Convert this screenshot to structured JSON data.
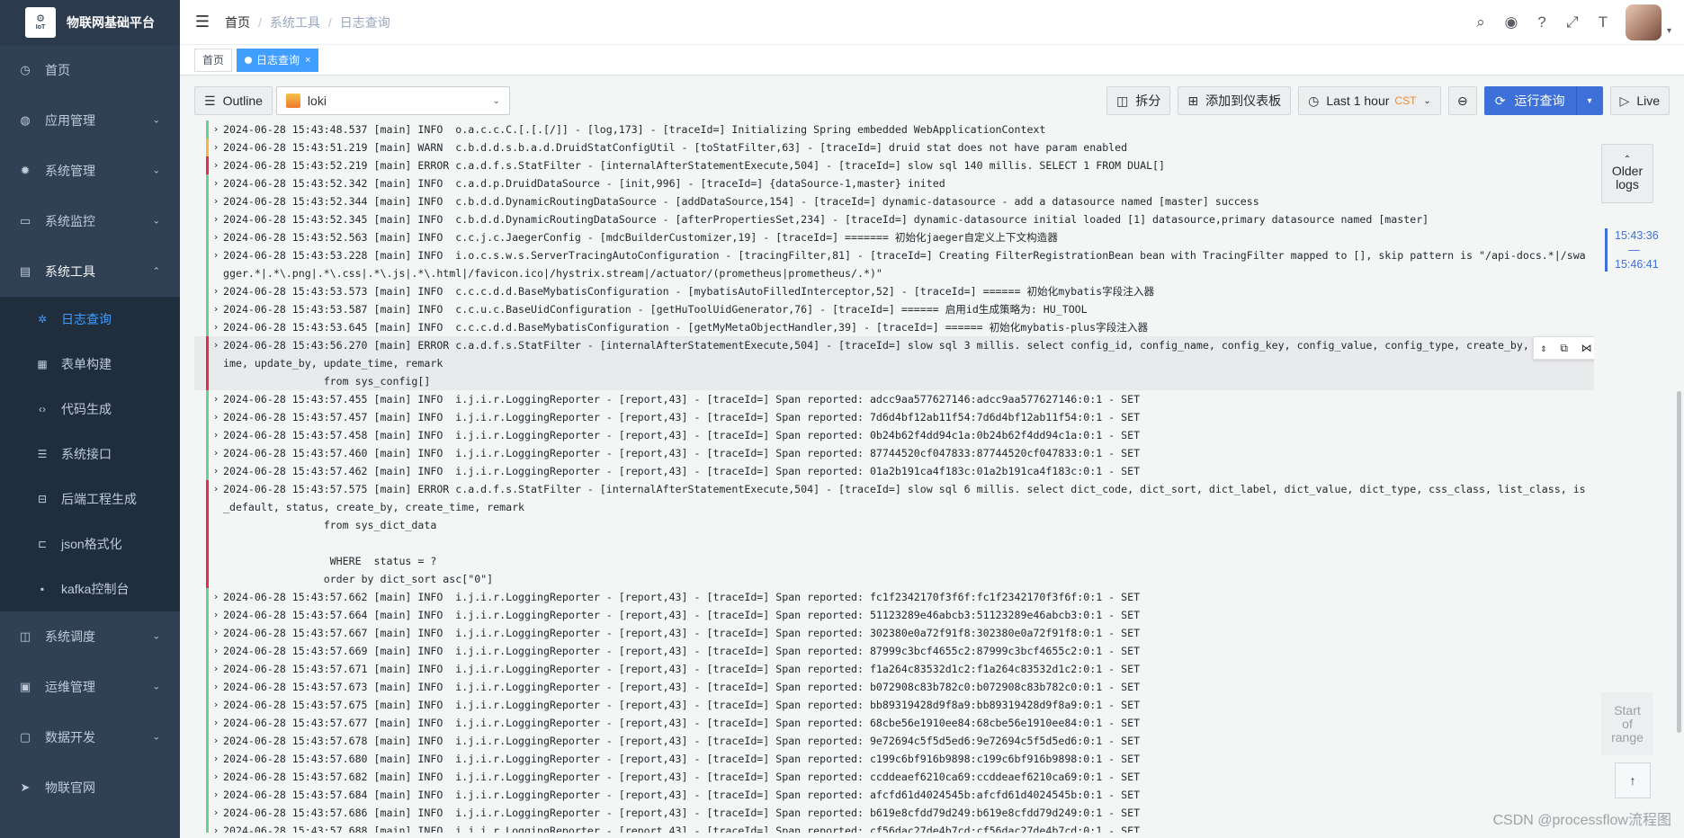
{
  "app": {
    "title": "物联网基础平台",
    "logo_text": "IoT"
  },
  "sidebar": {
    "items": [
      {
        "label": "首页",
        "icon": "dashboard-icon"
      },
      {
        "label": "应用管理",
        "icon": "globe-icon"
      },
      {
        "label": "系统管理",
        "icon": "gear-icon"
      },
      {
        "label": "系统监控",
        "icon": "monitor-icon"
      },
      {
        "label": "系统工具",
        "icon": "toolbox-icon"
      },
      {
        "label": "系统调度",
        "icon": "schedule-icon"
      },
      {
        "label": "运维管理",
        "icon": "ops-icon"
      },
      {
        "label": "数据开发",
        "icon": "data-icon"
      },
      {
        "label": "物联官网",
        "icon": "send-icon"
      }
    ],
    "sub_items": [
      {
        "label": "日志查询",
        "icon": "bug-icon"
      },
      {
        "label": "表单构建",
        "icon": "form-icon"
      },
      {
        "label": "代码生成",
        "icon": "code-icon"
      },
      {
        "label": "系统接口",
        "icon": "api-icon"
      },
      {
        "label": "后端工程生成",
        "icon": "build-icon"
      },
      {
        "label": "json格式化",
        "icon": "json-icon"
      },
      {
        "label": "kafka控制台",
        "icon": "chat-icon"
      }
    ]
  },
  "breadcrumb": {
    "home": "首页",
    "sep": "/",
    "level1": "系统工具",
    "level2": "日志查询"
  },
  "tags": {
    "home": "首页",
    "active": "日志查询",
    "close": "×"
  },
  "toolbar": {
    "outline": "Outline",
    "datasource": "loki",
    "split": "拆分",
    "add_dashboard": "添加到仪表板",
    "time_range": "Last 1 hour",
    "timezone": "CST",
    "run": "运行查询",
    "live": "Live"
  },
  "nav": {
    "older_1": "Older",
    "older_2": "logs",
    "range_start": "15:43:36",
    "range_dash": "—",
    "range_end": "15:46:41",
    "start_1": "Start",
    "start_2": "of",
    "start_3": "range",
    "to_top": "↑"
  },
  "watermark": "CSDN @processflow流程图",
  "logs": [
    {
      "level": "info",
      "text": "2024-06-28 15:43:48.537 [main] INFO  o.a.c.c.C.[.[.[/]] - [log,173] - [traceId=] Initializing Spring embedded WebApplicationContext"
    },
    {
      "level": "warn",
      "text": "2024-06-28 15:43:51.219 [main] WARN  c.b.d.d.s.b.a.d.DruidStatConfigUtil - [toStatFilter,63] - [traceId=] druid stat does not have param enabled"
    },
    {
      "level": "error",
      "text": "2024-06-28 15:43:52.219 [main] ERROR c.a.d.f.s.StatFilter - [internalAfterStatementExecute,504] - [traceId=] slow sql 140 millis. SELECT 1 FROM DUAL[]"
    },
    {
      "level": "info",
      "text": "2024-06-28 15:43:52.342 [main] INFO  c.a.d.p.DruidDataSource - [init,996] - [traceId=] {dataSource-1,master} inited"
    },
    {
      "level": "info",
      "text": "2024-06-28 15:43:52.344 [main] INFO  c.b.d.d.DynamicRoutingDataSource - [addDataSource,154] - [traceId=] dynamic-datasource - add a datasource named [master] success"
    },
    {
      "level": "info",
      "text": "2024-06-28 15:43:52.345 [main] INFO  c.b.d.d.DynamicRoutingDataSource - [afterPropertiesSet,234] - [traceId=] dynamic-datasource initial loaded [1] datasource,primary datasource named [master]"
    },
    {
      "level": "info",
      "text": "2024-06-28 15:43:52.563 [main] INFO  c.c.j.c.JaegerConfig - [mdcBuilderCustomizer,19] - [traceId=] ======= 初始化jaeger自定义上下文构造器"
    },
    {
      "level": "info",
      "text": "2024-06-28 15:43:53.228 [main] INFO  i.o.c.s.w.s.ServerTracingAutoConfiguration - [tracingFilter,81] - [traceId=] Creating FilterRegistrationBean bean with TracingFilter mapped to [], skip pattern is \"/api-docs.*|/swagger.*|.*\\.png|.*\\.css|.*\\.js|.*\\.html|/favicon.ico|/hystrix.stream|/actuator/(prometheus|prometheus/.*)\""
    },
    {
      "level": "info",
      "text": "2024-06-28 15:43:53.573 [main] INFO  c.c.c.d.d.BaseMybatisConfiguration - [mybatisAutoFilledInterceptor,52] - [traceId=] ====== 初始化mybatis字段注入器"
    },
    {
      "level": "info",
      "text": "2024-06-28 15:43:53.587 [main] INFO  c.c.u.c.BaseUidConfiguration - [getHuToolUidGenerator,76] - [traceId=] ====== 启用id生成策略为: HU_TOOL"
    },
    {
      "level": "info",
      "text": "2024-06-28 15:43:53.645 [main] INFO  c.c.c.d.d.BaseMybatisConfiguration - [getMyMetaObjectHandler,39] - [traceId=] ====== 初始化mybatis-plus字段注入器"
    },
    {
      "level": "error",
      "text": "2024-06-28 15:43:56.270 [main] ERROR c.a.d.f.s.StatFilter - [internalAfterStatementExecute,504] - [traceId=] slow sql 3 millis. select config_id, config_name, config_key, config_value, config_type, create_by, create_time, update_by, update_time, remark\n\t\tfrom sys_config[]",
      "selected": true
    },
    {
      "level": "info",
      "text": "2024-06-28 15:43:57.455 [main] INFO  i.j.i.r.LoggingReporter - [report,43] - [traceId=] Span reported: adcc9aa577627146:adcc9aa577627146:0:1 - SET"
    },
    {
      "level": "info",
      "text": "2024-06-28 15:43:57.457 [main] INFO  i.j.i.r.LoggingReporter - [report,43] - [traceId=] Span reported: 7d6d4bf12ab11f54:7d6d4bf12ab11f54:0:1 - SET"
    },
    {
      "level": "info",
      "text": "2024-06-28 15:43:57.458 [main] INFO  i.j.i.r.LoggingReporter - [report,43] - [traceId=] Span reported: 0b24b62f4dd94c1a:0b24b62f4dd94c1a:0:1 - SET"
    },
    {
      "level": "info",
      "text": "2024-06-28 15:43:57.460 [main] INFO  i.j.i.r.LoggingReporter - [report,43] - [traceId=] Span reported: 87744520cf047833:87744520cf047833:0:1 - SET"
    },
    {
      "level": "info",
      "text": "2024-06-28 15:43:57.462 [main] INFO  i.j.i.r.LoggingReporter - [report,43] - [traceId=] Span reported: 01a2b191ca4f183c:01a2b191ca4f183c:0:1 - SET"
    },
    {
      "level": "error",
      "text": "2024-06-28 15:43:57.575 [main] ERROR c.a.d.f.s.StatFilter - [internalAfterStatementExecute,504] - [traceId=] slow sql 6 millis. select dict_code, dict_sort, dict_label, dict_value, dict_type, css_class, list_class, is_default, status, create_by, create_time, remark\n\t\tfrom sys_dict_data\n\n\t\t WHERE  status = ?\n\t\torder by dict_sort asc[\"0\"]"
    },
    {
      "level": "info",
      "text": "2024-06-28 15:43:57.662 [main] INFO  i.j.i.r.LoggingReporter - [report,43] - [traceId=] Span reported: fc1f2342170f3f6f:fc1f2342170f3f6f:0:1 - SET"
    },
    {
      "level": "info",
      "text": "2024-06-28 15:43:57.664 [main] INFO  i.j.i.r.LoggingReporter - [report,43] - [traceId=] Span reported: 51123289e46abcb3:51123289e46abcb3:0:1 - SET"
    },
    {
      "level": "info",
      "text": "2024-06-28 15:43:57.667 [main] INFO  i.j.i.r.LoggingReporter - [report,43] - [traceId=] Span reported: 302380e0a72f91f8:302380e0a72f91f8:0:1 - SET"
    },
    {
      "level": "info",
      "text": "2024-06-28 15:43:57.669 [main] INFO  i.j.i.r.LoggingReporter - [report,43] - [traceId=] Span reported: 87999c3bcf4655c2:87999c3bcf4655c2:0:1 - SET"
    },
    {
      "level": "info",
      "text": "2024-06-28 15:43:57.671 [main] INFO  i.j.i.r.LoggingReporter - [report,43] - [traceId=] Span reported: f1a264c83532d1c2:f1a264c83532d1c2:0:1 - SET"
    },
    {
      "level": "info",
      "text": "2024-06-28 15:43:57.673 [main] INFO  i.j.i.r.LoggingReporter - [report,43] - [traceId=] Span reported: b072908c83b782c0:b072908c83b782c0:0:1 - SET"
    },
    {
      "level": "info",
      "text": "2024-06-28 15:43:57.675 [main] INFO  i.j.i.r.LoggingReporter - [report,43] - [traceId=] Span reported: bb89319428d9f8a9:bb89319428d9f8a9:0:1 - SET"
    },
    {
      "level": "info",
      "text": "2024-06-28 15:43:57.677 [main] INFO  i.j.i.r.LoggingReporter - [report,43] - [traceId=] Span reported: 68cbe56e1910ee84:68cbe56e1910ee84:0:1 - SET"
    },
    {
      "level": "info",
      "text": "2024-06-28 15:43:57.678 [main] INFO  i.j.i.r.LoggingReporter - [report,43] - [traceId=] Span reported: 9e72694c5f5d5ed6:9e72694c5f5d5ed6:0:1 - SET"
    },
    {
      "level": "info",
      "text": "2024-06-28 15:43:57.680 [main] INFO  i.j.i.r.LoggingReporter - [report,43] - [traceId=] Span reported: c199c6bf916b9898:c199c6bf916b9898:0:1 - SET"
    },
    {
      "level": "info",
      "text": "2024-06-28 15:43:57.682 [main] INFO  i.j.i.r.LoggingReporter - [report,43] - [traceId=] Span reported: ccddeaef6210ca69:ccddeaef6210ca69:0:1 - SET"
    },
    {
      "level": "info",
      "text": "2024-06-28 15:43:57.684 [main] INFO  i.j.i.r.LoggingReporter - [report,43] - [traceId=] Span reported: afcfd61d4024545b:afcfd61d4024545b:0:1 - SET"
    },
    {
      "level": "info",
      "text": "2024-06-28 15:43:57.686 [main] INFO  i.j.i.r.LoggingReporter - [report,43] - [traceId=] Span reported: b619e8cfdd79d249:b619e8cfdd79d249:0:1 - SET"
    },
    {
      "level": "info",
      "text": "2024-06-28 15:43:57.688 [main] INFO  i.j.i.r.LoggingReporter - [report,43] - [traceId=] Span reported: cf56dac27de4b7cd:cf56dac27de4b7cd:0:1 - SET"
    }
  ]
}
